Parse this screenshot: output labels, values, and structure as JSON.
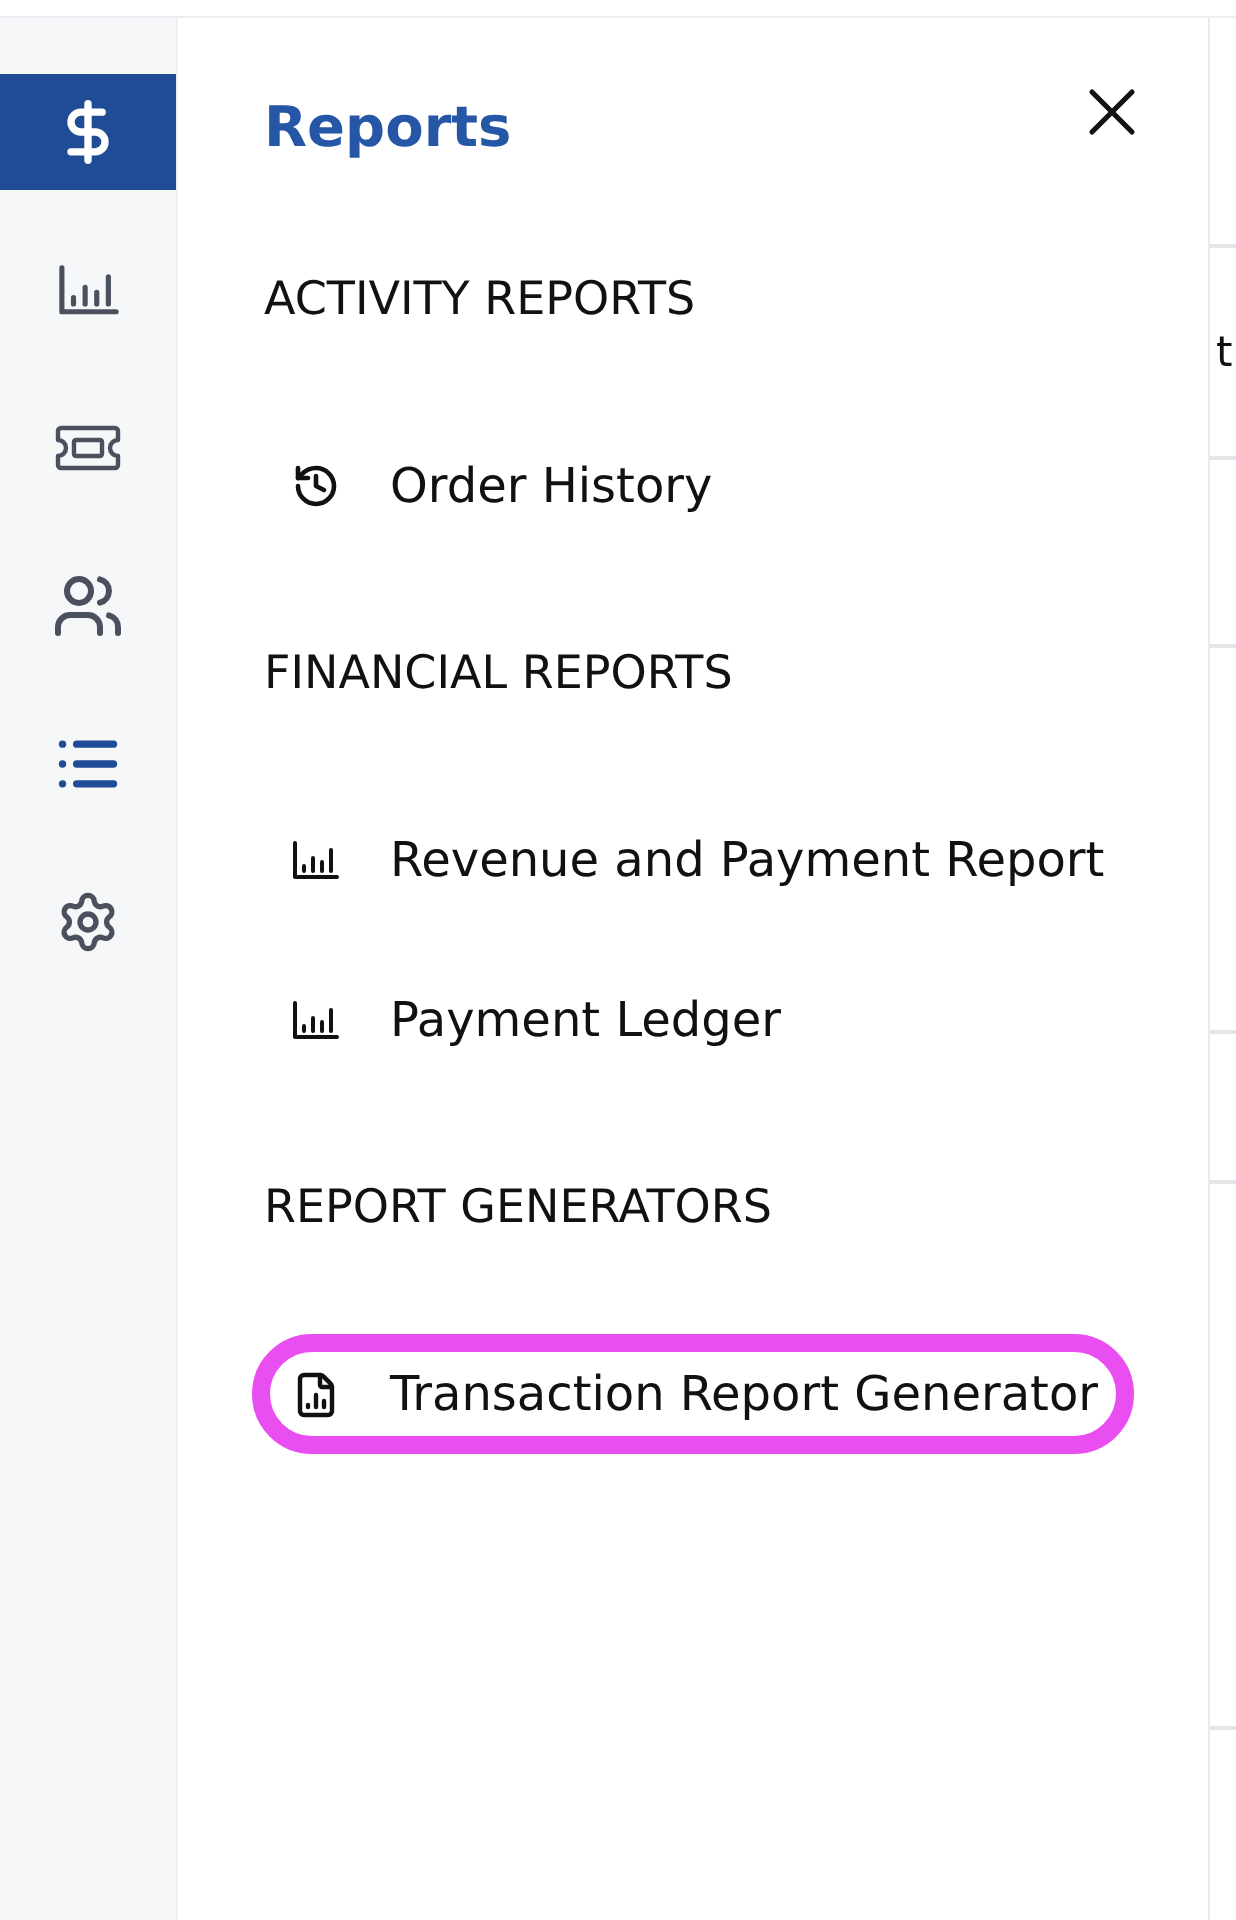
{
  "sidebar": {
    "items": [
      {
        "selected": true,
        "open": false
      },
      {
        "selected": false,
        "open": false
      },
      {
        "selected": false,
        "open": false
      },
      {
        "selected": false,
        "open": false
      },
      {
        "selected": false,
        "open": true
      },
      {
        "selected": false,
        "open": false
      }
    ]
  },
  "panel": {
    "title": "Reports",
    "sections": [
      {
        "heading": "ACTIVITY REPORTS",
        "items": [
          {
            "label": "Order History",
            "kind": "history",
            "highlighted": false
          }
        ]
      },
      {
        "heading": "FINANCIAL REPORTS",
        "items": [
          {
            "label": "Revenue and Payment Report",
            "kind": "report",
            "highlighted": false
          },
          {
            "label": "Payment Ledger",
            "kind": "report",
            "highlighted": false
          }
        ]
      },
      {
        "heading": "REPORT GENERATORS",
        "items": [
          {
            "label": "Transaction Report Generator",
            "kind": "generator",
            "highlighted": true
          }
        ]
      }
    ]
  },
  "background_page": {
    "text": "t"
  }
}
